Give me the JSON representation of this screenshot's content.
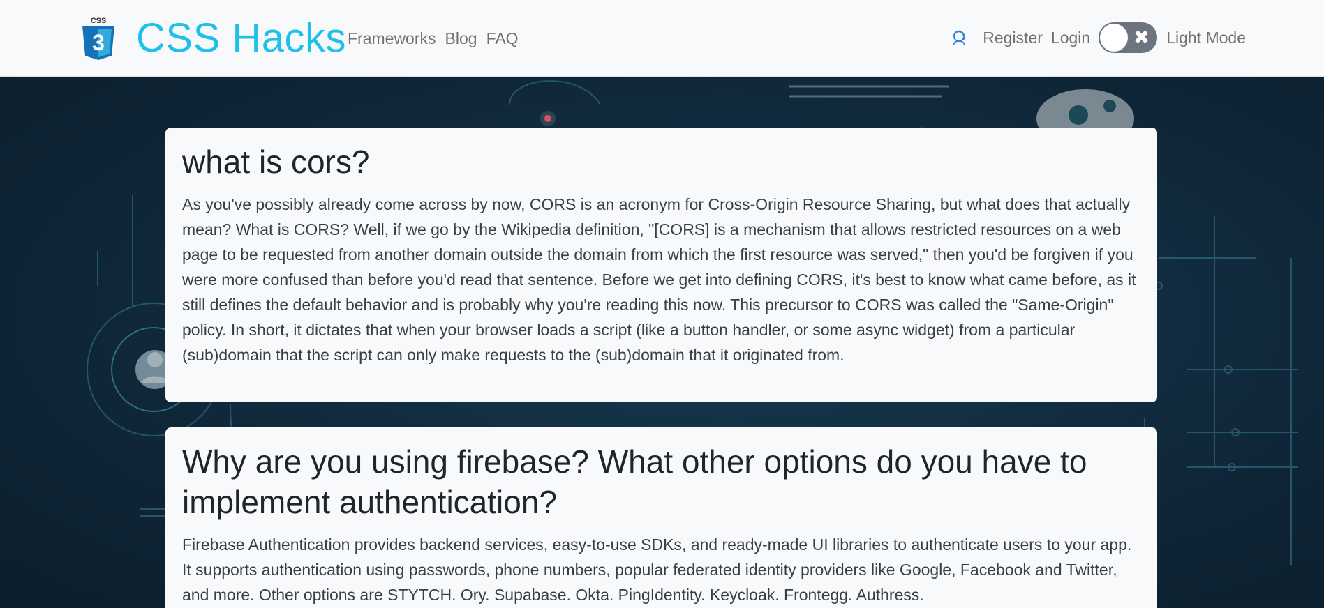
{
  "brand": {
    "logo_text": "CSS",
    "logo_digit": "3",
    "name": "CSS Hacks"
  },
  "nav": {
    "links": [
      "Frameworks",
      "Blog",
      "FAQ"
    ],
    "register": "Register",
    "login": "Login",
    "mode_label": "Light Mode",
    "icons": [
      "user-support-icon",
      "close-icon"
    ]
  },
  "colors": {
    "brand": "#1fc0ea",
    "navbar_bg": "#f8f9fa",
    "toggle_bg": "#6c757d",
    "card_bg": "#f8f9fa",
    "hero_bg": "#10283a"
  },
  "sections": [
    {
      "title": "what is cors?",
      "body": "As you've possibly already come across by now, CORS is an acronym for Cross-Origin Resource Sharing, but what does that actually mean? What is CORS? Well, if we go by the Wikipedia definition, \"[CORS] is a mechanism that allows restricted resources on a web page to be requested from another domain outside the domain from which the first resource was served,\" then you'd be forgiven if you were more confused than before you'd read that sentence. Before we get into defining CORS, it's best to know what came before, as it still defines the default behavior and is probably why you're reading this now. This precursor to CORS was called the \"Same-Origin\" policy. In short, it dictates that when your browser loads a script (like a button handler, or some async widget) from a particular (sub)domain that the script can only make requests to the (sub)domain that it originated from."
    },
    {
      "title": "Why are you using firebase? What other options do you have to implement authentication?",
      "body": "Firebase Authentication provides backend services, easy-to-use SDKs, and ready-made UI libraries to authenticate users to your app. It supports authentication using passwords, phone numbers, popular federated identity providers like Google, Facebook and Twitter, and more. Other options are STYTCH. Ory. Supabase. Okta. PingIdentity. Keycloak. Frontegg. Authress."
    }
  ]
}
